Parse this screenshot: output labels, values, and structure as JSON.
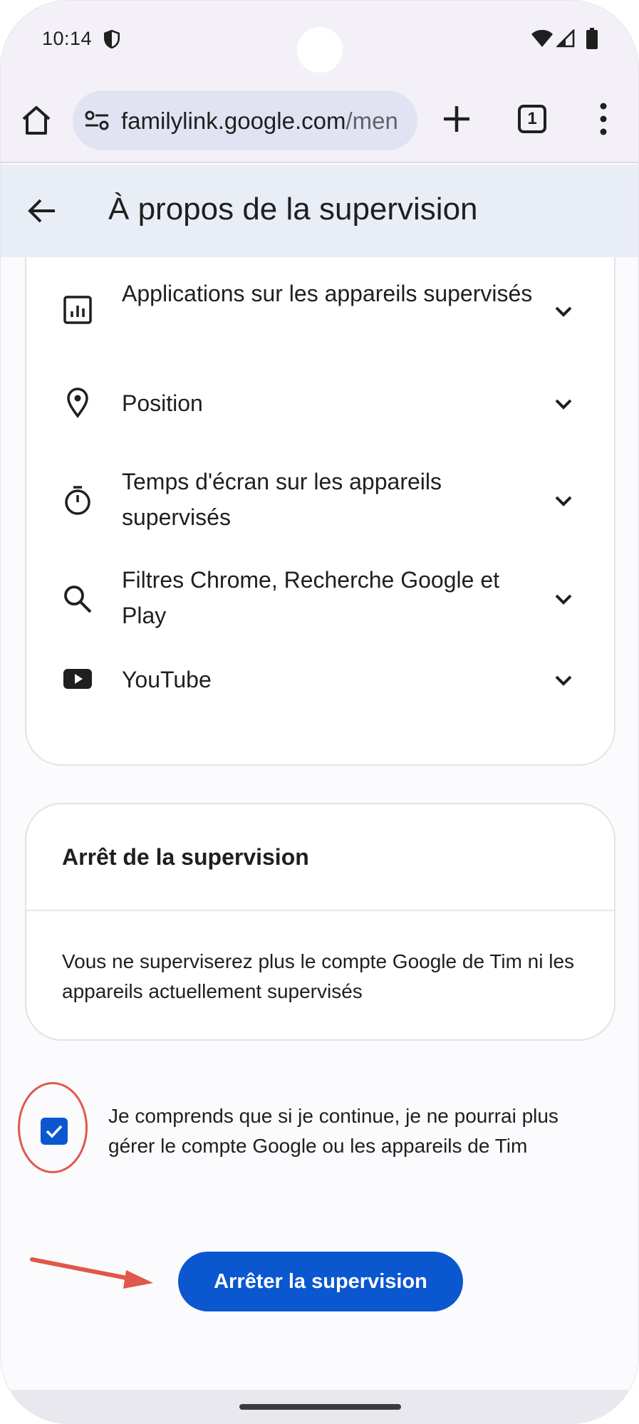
{
  "status_bar": {
    "time": "10:14",
    "icons": [
      "shield-icon",
      "wifi-icon",
      "signal-icon",
      "battery-icon"
    ]
  },
  "browser": {
    "url_domain": "familylink.google.com",
    "url_path": "/men",
    "tab_count": "1",
    "icons": [
      "home-icon",
      "tune-icon",
      "plus-icon",
      "more-vert-icon"
    ]
  },
  "app_bar": {
    "title": "À propos de la supervision",
    "back_icon": "arrow-back-icon"
  },
  "supervision_list": [
    {
      "label": "Applications sur les appareils supervisés",
      "icon": "app-activity-icon"
    },
    {
      "label": "Position",
      "icon": "location-pin-icon"
    },
    {
      "label": "Temps d'écran sur les appareils supervisés",
      "icon": "timer-icon"
    },
    {
      "label": "Filtres Chrome, Recherche Google et Play",
      "icon": "search-icon"
    },
    {
      "label": "YouTube",
      "icon": "youtube-icon"
    }
  ],
  "stop_card": {
    "title": "Arrêt de la supervision",
    "body": "Vous ne superviserez plus le compte Google de Tim ni les appareils actuellement supervisés"
  },
  "confirm": {
    "checked": true,
    "label": "Je comprends que si je continue, je ne pourrai plus gérer le compte Google ou les appareils de Tim"
  },
  "stop_button": {
    "label": "Arrêter la supervision"
  },
  "colors": {
    "accent": "#0b57d0",
    "annotation": "#e0574b",
    "app_bar_bg": "#e9eef6"
  }
}
